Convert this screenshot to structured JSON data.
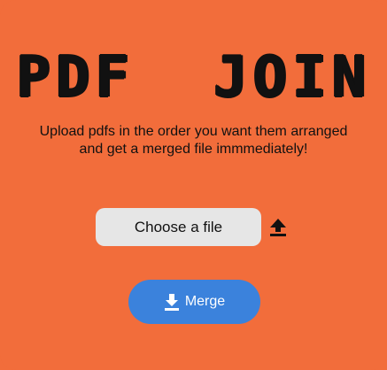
{
  "header": {
    "title": "PDF  JOIN",
    "subtitle": "Upload pdfs in the order you want them arranged and get a merged file immmediately!"
  },
  "file_input": {
    "button_label": "Choose a file",
    "icon": "upload-icon"
  },
  "actions": {
    "merge_label": "Merge",
    "merge_icon": "download-icon"
  },
  "colors": {
    "background": "#f26d3b",
    "choose_button": "#e6e6e6",
    "merge_button": "#3b82dc"
  }
}
